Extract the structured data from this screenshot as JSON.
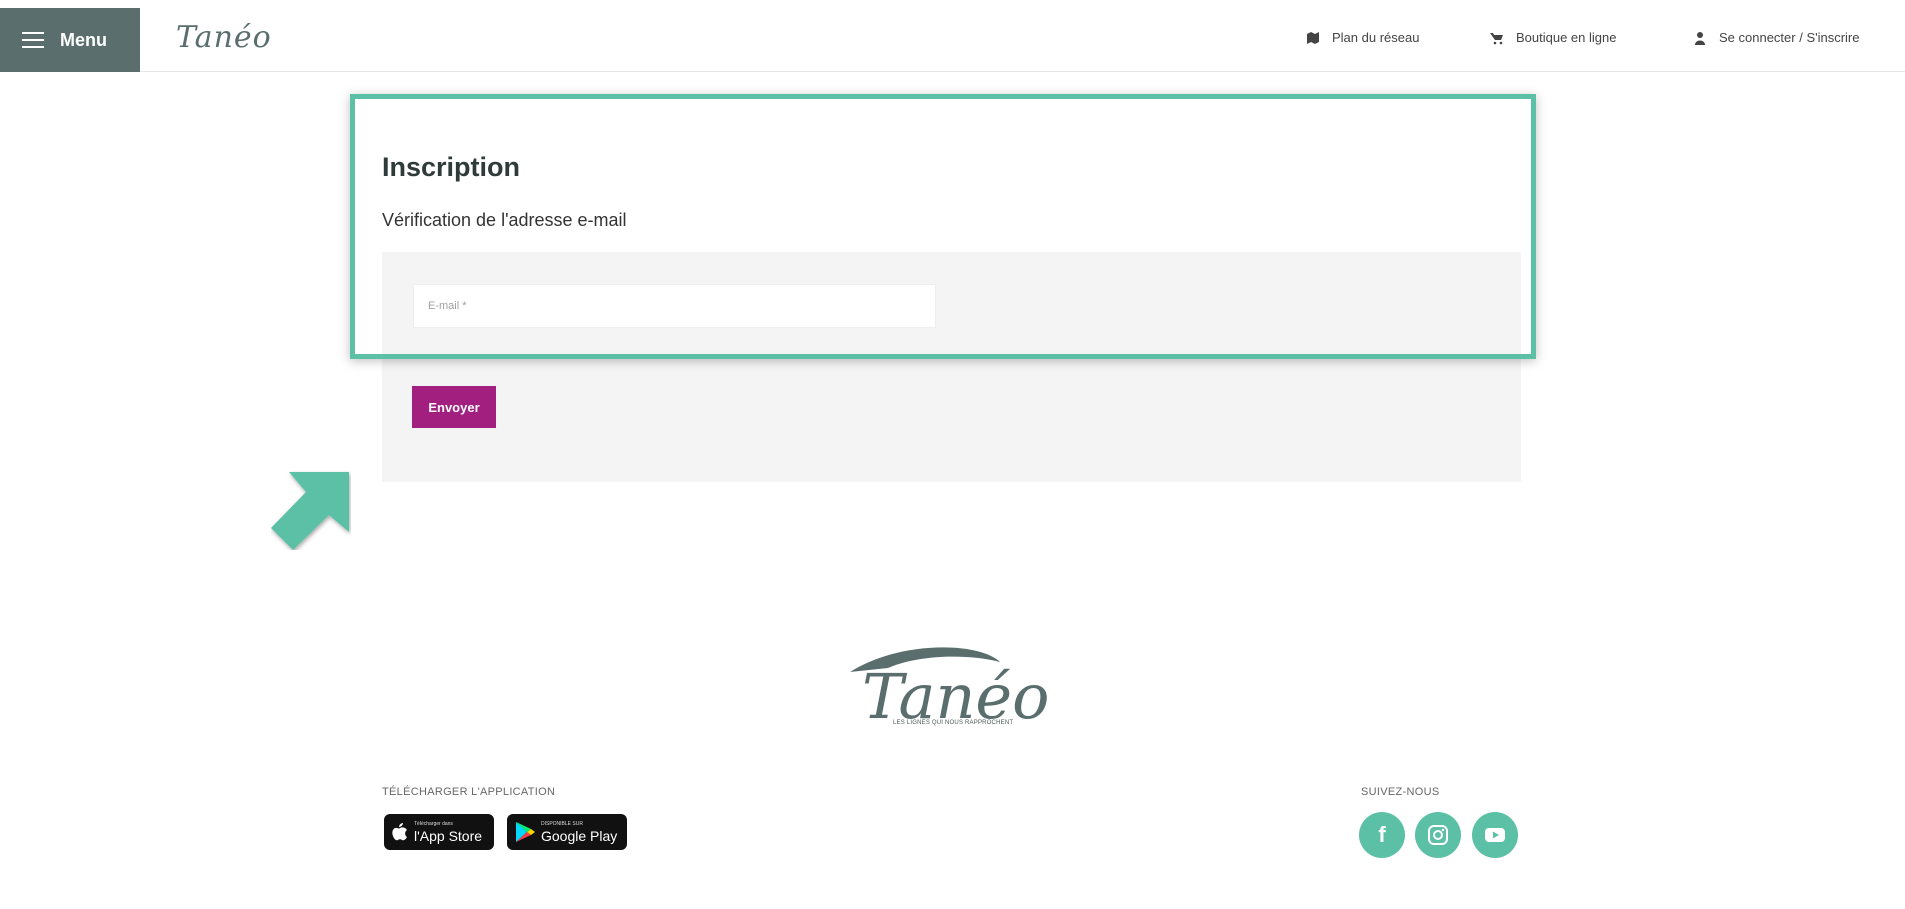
{
  "header": {
    "menu_label": "Menu",
    "logo_text": "Tanéo",
    "links": {
      "plan": "Plan du réseau",
      "shop": "Boutique en ligne",
      "login": "Se connecter / S'inscrire"
    }
  },
  "form": {
    "title": "Inscription",
    "subtitle": "Vérification de l'adresse e-mail",
    "email_placeholder": "E-mail *",
    "email_value": "",
    "submit_label": "Envoyer"
  },
  "footer": {
    "logo_text": "Tanéo",
    "tagline": "LES LIGNES QUI NOUS RAPPROCHENT",
    "download_heading": "TÉLÉCHARGER L'APPLICATION",
    "appstore_small": "Télécharger dans",
    "appstore_big": "l'App Store",
    "googleplay_small": "DISPONIBLE SUR",
    "googleplay_big": "Google Play",
    "social_heading": "SUIVEZ-NOUS",
    "social_icons": [
      "facebook-icon",
      "instagram-icon",
      "youtube-icon"
    ]
  },
  "colors": {
    "menu_bg": "#5a6e6e",
    "accent_teal": "#5cc0a6",
    "button_magenta": "#a31f7f",
    "panel_grey": "#f4f4f4"
  }
}
